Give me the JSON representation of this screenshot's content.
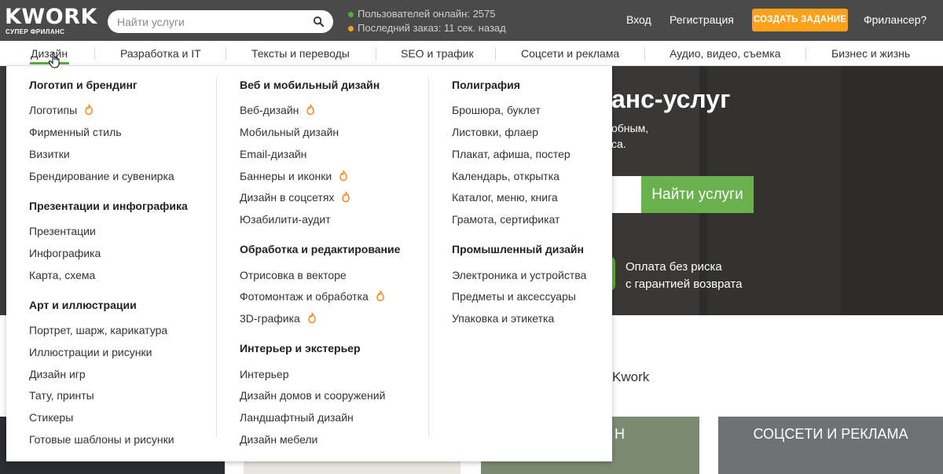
{
  "header": {
    "logo_text": "KWORK",
    "logo_sub": "СУПЕР ФРИЛАНС",
    "search_placeholder": "Найти услуги",
    "stats": [
      {
        "text": "Пользователей онлайн: 2575",
        "color": "#5bab3a"
      },
      {
        "text": "Последний заказ: 11 сек. назад",
        "color": "#ffa21a"
      }
    ],
    "login": "Вход",
    "register": "Регистрация",
    "cta": "СОЗДАТЬ ЗАДАНИЕ",
    "freelancer": "Фрилансер?"
  },
  "colors": {
    "header_bg": "#4a4a4a",
    "accent_green": "#5bab3a",
    "accent_orange": "#ffa21a"
  },
  "categories": [
    "Дизайн",
    "Разработка и IT",
    "Тексты и переводы",
    "SEO и трафик",
    "Соцсети и реклама",
    "Аудио, видео, съемка",
    "Бизнес и жизнь"
  ],
  "active_category": "Дизайн",
  "dropdown": {
    "columns": [
      {
        "groups": [
          {
            "title": "Логотип и брендинг",
            "items": [
              {
                "label": "Логотипы",
                "hot": true
              },
              {
                "label": "Фирменный стиль",
                "hot": false
              },
              {
                "label": "Визитки",
                "hot": false
              },
              {
                "label": "Брендирование и сувенирка",
                "hot": false
              }
            ]
          },
          {
            "title": "Презентации и инфографика",
            "items": [
              {
                "label": "Презентации",
                "hot": false
              },
              {
                "label": "Инфографика",
                "hot": false
              },
              {
                "label": "Карта, схема",
                "hot": false
              }
            ]
          },
          {
            "title": "Арт и иллюстрации",
            "items": [
              {
                "label": "Портрет, шарж, карикатура",
                "hot": false
              },
              {
                "label": "Иллюстрации и рисунки",
                "hot": false
              },
              {
                "label": "Дизайн игр",
                "hot": false
              },
              {
                "label": "Тату, принты",
                "hot": false
              },
              {
                "label": "Стикеры",
                "hot": false
              },
              {
                "label": "Готовые шаблоны и рисунки",
                "hot": false
              }
            ]
          }
        ]
      },
      {
        "groups": [
          {
            "title": "Веб и мобильный дизайн",
            "items": [
              {
                "label": "Веб-дизайн",
                "hot": true
              },
              {
                "label": "Мобильный дизайн",
                "hot": false
              },
              {
                "label": "Email-дизайн",
                "hot": false
              },
              {
                "label": "Баннеры и иконки",
                "hot": true
              },
              {
                "label": "Дизайн в соцсетях",
                "hot": true
              },
              {
                "label": "Юзабилити-аудит",
                "hot": false
              }
            ]
          },
          {
            "title": "Обработка и редактирование",
            "items": [
              {
                "label": "Отрисовка в векторе",
                "hot": false
              },
              {
                "label": "Фотомонтаж и обработка",
                "hot": true
              },
              {
                "label": "3D-графика",
                "hot": true
              }
            ]
          },
          {
            "title": "Интерьер и экстерьер",
            "items": [
              {
                "label": "Интерьер",
                "hot": false
              },
              {
                "label": "Дизайн домов и сооружений",
                "hot": false
              },
              {
                "label": "Ландшафтный дизайн",
                "hot": false
              },
              {
                "label": "Дизайн мебели",
                "hot": false
              }
            ]
          }
        ]
      },
      {
        "groups": [
          {
            "title": "Полиграфия",
            "items": [
              {
                "label": "Брошюра, буклет",
                "hot": false
              },
              {
                "label": "Листовки, флаер",
                "hot": false
              },
              {
                "label": "Плакат, афиша, постер",
                "hot": false
              },
              {
                "label": "Календарь, открытка",
                "hot": false
              },
              {
                "label": "Каталог, меню, книга",
                "hot": false
              },
              {
                "label": "Грамота, сертификат",
                "hot": false
              }
            ]
          },
          {
            "title": "Промышленный дизайн",
            "items": [
              {
                "label": "Электроника и устройства",
                "hot": false
              },
              {
                "label": "Предметы и аксессуары",
                "hot": false
              },
              {
                "label": "Упаковка и этикетка",
                "hot": false
              }
            ]
          }
        ]
      }
    ]
  },
  "hero": {
    "title_partial": "анс-услуг",
    "sub_line1": "обным,",
    "sub_line2": "са.",
    "search_button": "Найти услуги",
    "guarantee_line1": "Оплата без риска",
    "guarantee_line2": "с гарантией возврата"
  },
  "below": {
    "kwork_text": "Kwork",
    "card_partial_label": "Н",
    "card_label": "СОЦСЕТИ И РЕКЛАМА"
  }
}
